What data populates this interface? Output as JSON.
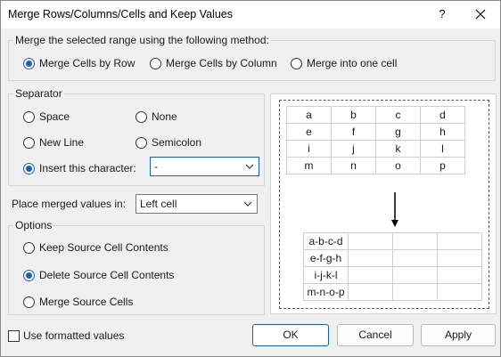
{
  "window": {
    "title": "Merge Rows/Columns/Cells and Keep Values",
    "help_glyph": "?"
  },
  "method_group": {
    "label": "Merge the selected range using the following method:",
    "options": [
      {
        "label": "Merge Cells by Row",
        "checked": true
      },
      {
        "label": "Merge Cells by Column",
        "checked": false
      },
      {
        "label": "Merge into one cell",
        "checked": false
      }
    ]
  },
  "separator_group": {
    "label": "Separator",
    "space": "Space",
    "none": "None",
    "new_line": "New Line",
    "semicolon": "Semicolon",
    "insert_char": "Insert this character:",
    "char_value": "-"
  },
  "place": {
    "label": "Place merged values in:",
    "value": "Left cell"
  },
  "options_group": {
    "label": "Options",
    "keep": "Keep Source Cell Contents",
    "delete": "Delete Source Cell Contents",
    "merge": "Merge Source Cells"
  },
  "preview": {
    "source": [
      [
        "a",
        "b",
        "c",
        "d"
      ],
      [
        "e",
        "f",
        "g",
        "h"
      ],
      [
        "i",
        "j",
        "k",
        "l"
      ],
      [
        "m",
        "n",
        "o",
        "p"
      ]
    ],
    "result": [
      [
        "a-b-c-d",
        "",
        "",
        ""
      ],
      [
        "e-f-g-h",
        "",
        "",
        ""
      ],
      [
        "i-j-k-l",
        "",
        "",
        ""
      ],
      [
        "m-n-o-p",
        "",
        "",
        ""
      ]
    ]
  },
  "footer": {
    "use_formatted": "Use formatted values",
    "ok": "OK",
    "cancel": "Cancel",
    "apply": "Apply"
  },
  "colors": {
    "accent": "#1a5fb4",
    "dialog_bg": "#f0f0f0"
  },
  "icons": {
    "close": "close-icon",
    "dropdown": "chevron-down-icon",
    "arrow": "arrow-down-icon"
  }
}
